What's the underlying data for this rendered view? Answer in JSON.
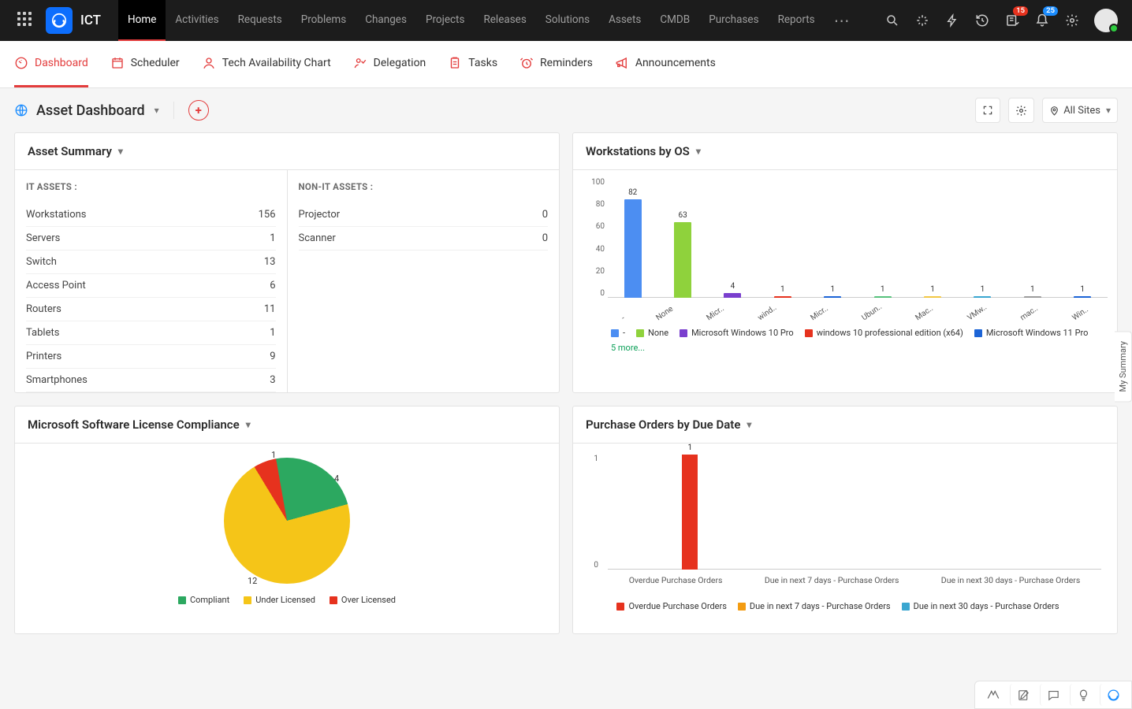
{
  "brand": "ICT",
  "topnav": [
    "Home",
    "Activities",
    "Requests",
    "Problems",
    "Changes",
    "Projects",
    "Releases",
    "Solutions",
    "Assets",
    "CMDB",
    "Purchases",
    "Reports"
  ],
  "topnav_active": 0,
  "badges": {
    "inbox": "15",
    "bell": "25"
  },
  "subtabs": [
    {
      "label": "Dashboard",
      "icon": "dash"
    },
    {
      "label": "Scheduler",
      "icon": "cal"
    },
    {
      "label": "Tech Availability Chart",
      "icon": "person"
    },
    {
      "label": "Delegation",
      "icon": "deleg"
    },
    {
      "label": "Tasks",
      "icon": "clip"
    },
    {
      "label": "Reminders",
      "icon": "alarm"
    },
    {
      "label": "Announcements",
      "icon": "mega"
    }
  ],
  "subtab_active": 0,
  "dashboard_name": "Asset Dashboard",
  "sites_label": "All Sites",
  "sidefloat": "My Summary",
  "cards": {
    "asset_summary": {
      "title": "Asset Summary",
      "it_head": "IT ASSETS :",
      "nonit_head": "NON-IT ASSETS :",
      "it": [
        {
          "n": "Workstations",
          "v": "156"
        },
        {
          "n": "Servers",
          "v": "1"
        },
        {
          "n": "Switch",
          "v": "13"
        },
        {
          "n": "Access Point",
          "v": "6"
        },
        {
          "n": "Routers",
          "v": "11"
        },
        {
          "n": "Tablets",
          "v": "1"
        },
        {
          "n": "Printers",
          "v": "9"
        },
        {
          "n": "Smartphones",
          "v": "3"
        }
      ],
      "nonit": [
        {
          "n": "Projector",
          "v": "0"
        },
        {
          "n": "Scanner",
          "v": "0"
        }
      ]
    },
    "workstations": {
      "title": "Workstations by OS",
      "more": "5 more..."
    },
    "license": {
      "title": "Microsoft Software License Compliance"
    },
    "po": {
      "title": "Purchase Orders by Due Date"
    }
  },
  "chart_data": [
    {
      "id": "workstations_by_os",
      "type": "bar",
      "ylim": [
        0,
        100
      ],
      "yticks": [
        0,
        20,
        40,
        60,
        80,
        100
      ],
      "categories": [
        "-",
        "None",
        "Micr..",
        "wind..",
        "Micr..",
        "Ubun..",
        "Mac..",
        "VMw..",
        "mac..",
        "Win.."
      ],
      "values": [
        82,
        63,
        4,
        1,
        1,
        1,
        1,
        1,
        1,
        1
      ],
      "colors": [
        "#4c8ef2",
        "#8fd23c",
        "#7a3fce",
        "#e6321e",
        "#1c64d6",
        "#56c17b",
        "#f2c744",
        "#3aa6d0",
        "#9c9c9c",
        "#1c64d6"
      ],
      "legend": [
        {
          "name": "-",
          "color": "#4c8ef2"
        },
        {
          "name": "None",
          "color": "#8fd23c"
        },
        {
          "name": "Microsoft Windows 10 Pro",
          "color": "#7a3fce"
        },
        {
          "name": "windows 10 professional edition (x64)",
          "color": "#e6321e"
        },
        {
          "name": "Microsoft Windows 11 Pro",
          "color": "#1c64d6"
        }
      ]
    },
    {
      "id": "license_compliance",
      "type": "pie",
      "series": [
        {
          "name": "Compliant",
          "value": 4,
          "color": "#2ca860"
        },
        {
          "name": "Under Licensed",
          "value": 12,
          "color": "#f5c518"
        },
        {
          "name": "Over Licensed",
          "value": 1,
          "color": "#e6321e"
        }
      ]
    },
    {
      "id": "po_by_due",
      "type": "bar",
      "ylim": [
        0,
        1
      ],
      "yticks": [
        0,
        1
      ],
      "categories": [
        "Overdue Purchase Orders",
        "Due in next 7 days - Purchase Orders",
        "Due in next 30 days - Purchase Orders"
      ],
      "values": [
        1,
        0,
        0
      ],
      "colors": [
        "#e6321e",
        "#f39c12",
        "#3aa6d0"
      ],
      "legend": [
        {
          "name": "Overdue Purchase Orders",
          "color": "#e6321e"
        },
        {
          "name": "Due in next 7 days - Purchase Orders",
          "color": "#f39c12"
        },
        {
          "name": "Due in next 30 days - Purchase Orders",
          "color": "#3aa6d0"
        }
      ]
    }
  ]
}
